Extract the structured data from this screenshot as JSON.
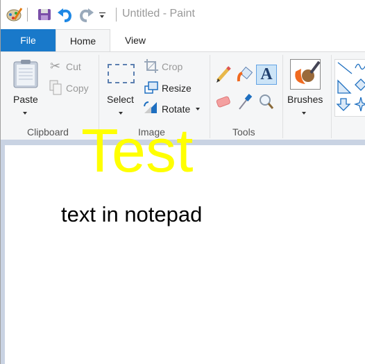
{
  "window": {
    "title": "Untitled - Paint"
  },
  "quick_access": {
    "icons": [
      "paint-app-icon",
      "save-icon",
      "undo-icon",
      "redo-icon",
      "customize-icon"
    ]
  },
  "tabs": [
    {
      "label": "File",
      "active": false
    },
    {
      "label": "Home",
      "active": true
    },
    {
      "label": "View",
      "active": false
    }
  ],
  "ribbon": {
    "clipboard": {
      "group": "Clipboard",
      "paste": "Paste",
      "cut": "Cut",
      "copy": "Copy"
    },
    "image": {
      "group": "Image",
      "select": "Select",
      "crop": "Crop",
      "resize": "Resize",
      "rotate": "Rotate"
    },
    "tools": {
      "group": "Tools",
      "selected": "text"
    },
    "brushes": {
      "label": "Brushes"
    }
  },
  "canvas": {
    "texts": [
      {
        "text": "Test",
        "color": "#ffff00"
      },
      {
        "text": "text in notepad",
        "color": "#000000"
      }
    ]
  },
  "colors": {
    "file_tab": "#1979ca",
    "band": "#c9d3e3"
  }
}
